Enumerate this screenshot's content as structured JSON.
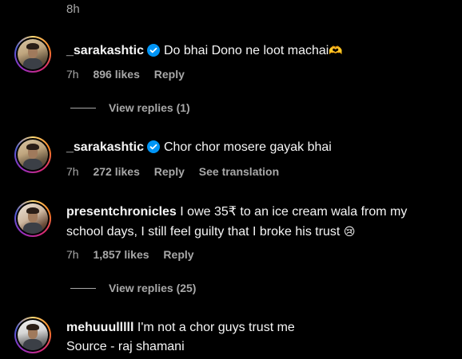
{
  "top_time": "8h",
  "comments": [
    {
      "username": "_sarakashtic",
      "verified": true,
      "text": "Do bhai Dono ne loot machai",
      "emoji": "🫶",
      "time": "7h",
      "likes": "896 likes",
      "reply": "Reply",
      "view_replies": "View replies (1)"
    },
    {
      "username": "_sarakashtic",
      "verified": true,
      "text": "Chor chor mosere gayak bhai",
      "time": "7h",
      "likes": "272 likes",
      "reply": "Reply",
      "see_translation": "See translation"
    },
    {
      "username": "presentchronicles",
      "text": "I owe 35₹ to an ice cream wala from my school days, I still feel guilty that I broke his trust",
      "emoji": "😢",
      "time": "7h",
      "likes": "1,857 likes",
      "reply": "Reply",
      "view_replies": "View replies (25)"
    },
    {
      "username": "mehuuulllll",
      "text": "I'm not a chor guys trust me",
      "text2": "Source - raj shamani"
    }
  ],
  "colors": {
    "verified": "#0095f6",
    "secondary": "#a8a8a8"
  }
}
